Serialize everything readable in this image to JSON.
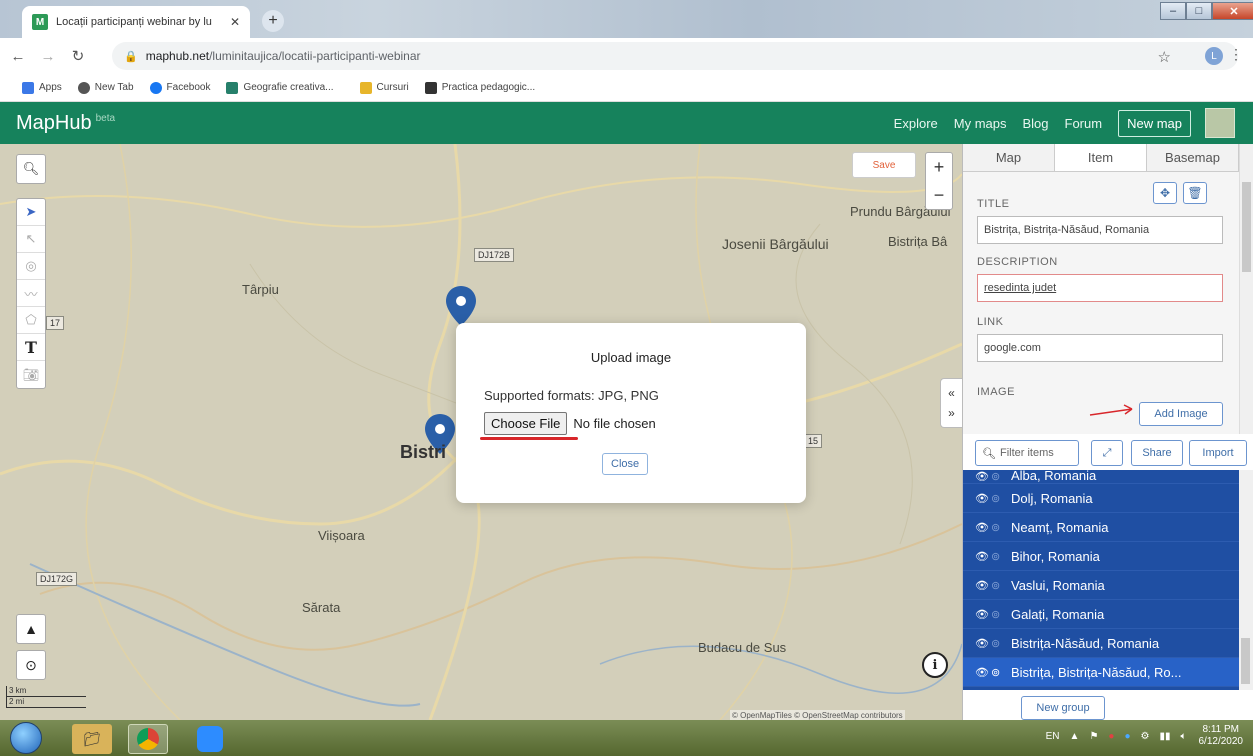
{
  "browser": {
    "tab_title": "Locații participanți webinar by lu",
    "favicon_letter": "M",
    "url_host": "maphub.net",
    "url_path": "/luminitaujica/locatii-participanti-webinar",
    "profile_initial": "L",
    "bookmarks": [
      "Apps",
      "New Tab",
      "Facebook",
      "Geografie creativa...",
      "Cursuri",
      "Practica pedagogic..."
    ]
  },
  "app": {
    "logo": "MapHub",
    "logo_badge": "beta",
    "nav": [
      "Explore",
      "My maps",
      "Blog",
      "Forum"
    ],
    "new_map": "New map"
  },
  "map": {
    "save_label": "Save",
    "labels": [
      "Prundu Bârgăului",
      "Josenii Bârgăului",
      "Bistrița Bâ",
      "Târpiu",
      "Bistri",
      "Viișoara",
      "Sărata",
      "Budacu de Sus"
    ],
    "road_badges": [
      "DJ172B",
      "DJ172G",
      "17",
      "15"
    ],
    "scale_km": "3 km",
    "scale_mi": "2 mi",
    "attribution": "© OpenMapTiles © OpenStreetMap contributors"
  },
  "modal": {
    "title": "Upload image",
    "formats": "Supported formats: JPG, PNG",
    "choose_file": "Choose File",
    "no_file": "No file chosen",
    "close": "Close"
  },
  "sidebar": {
    "tabs": [
      "Map",
      "Item",
      "Basemap"
    ],
    "title_label": "TITLE",
    "title_value": "Bistrița, Bistrița-Năsăud, Romania",
    "description_label": "DESCRIPTION",
    "description_value": "resedinta judet",
    "link_label": "LINK",
    "link_value": "google.com",
    "image_label": "IMAGE",
    "add_image": "Add Image",
    "filter_placeholder": "Filter items",
    "share": "Share",
    "import": "Import",
    "items": [
      "Alba, Romania",
      "Dolj, Romania",
      "Neamț, Romania",
      "Bihor, Romania",
      "Vaslui, Romania",
      "Galați, Romania",
      "Bistrița-Năsăud, Romania",
      "Bistrița, Bistrița-Năsăud, Ro..."
    ],
    "new_group": "New group"
  },
  "taskbar": {
    "lang": "EN",
    "time": "8:11 PM",
    "date": "6/12/2020"
  },
  "colors": {
    "brand_green": "#16825c",
    "list_blue": "#1f4fa3",
    "annotation_red": "#d8262a"
  }
}
